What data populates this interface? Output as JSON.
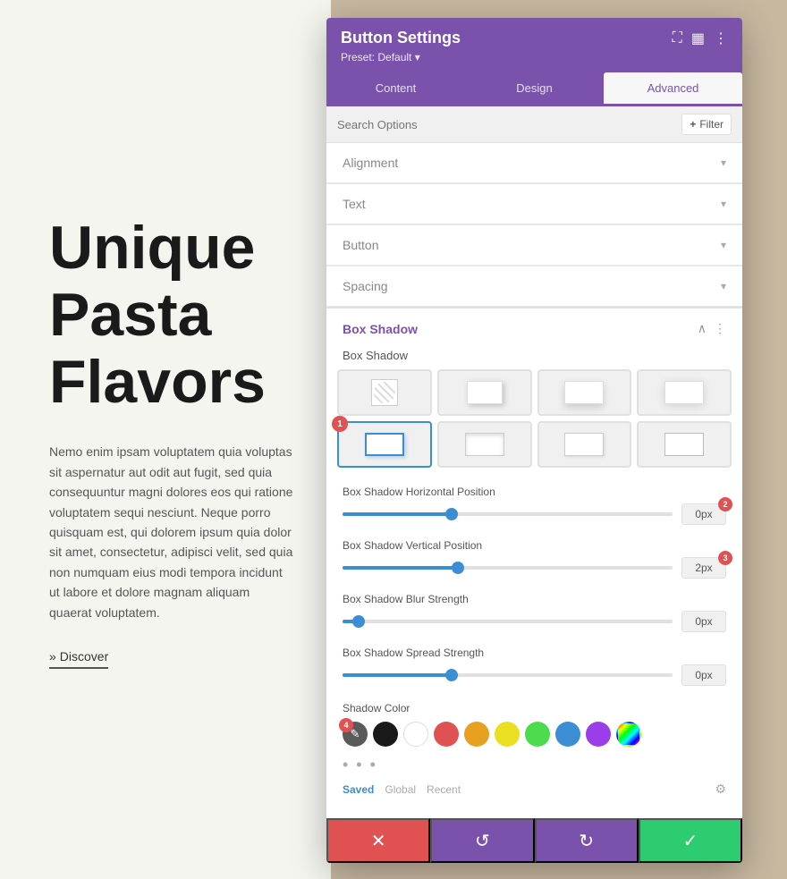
{
  "background": {
    "left_color": "#f5f5f0",
    "right_color": "#c8b8a0"
  },
  "page": {
    "title_line1": "Unique",
    "title_line2": "Pasta",
    "title_line3": "Flavors",
    "body_text": "Nemo enim ipsam voluptatem quia voluptas sit aspernatur aut odit aut fugit, sed quia consequuntur magni dolores eos qui ratione voluptatem sequi nesciunt. Neque porro quisquam est, qui dolorem ipsum quia dolor sit amet, consectetur, adipisci velit, sed quia non numquam eius modi tempora incidunt ut labore et dolore magnam aliquam quaerat voluptatem.",
    "link_text": "Discover"
  },
  "panel": {
    "title": "Button Settings",
    "preset_label": "Preset: Default",
    "tabs": [
      {
        "label": "Content",
        "active": false
      },
      {
        "label": "Design",
        "active": false
      },
      {
        "label": "Advanced",
        "active": true
      }
    ],
    "search_placeholder": "Search Options",
    "filter_label": "Filter",
    "sections": [
      {
        "label": "Alignment"
      },
      {
        "label": "Text"
      },
      {
        "label": "Button"
      },
      {
        "label": "Spacing"
      }
    ],
    "box_shadow": {
      "title": "Box Shadow",
      "shadow_label": "Box Shadow",
      "shadow_options": [
        {
          "type": "none",
          "selected": false
        },
        {
          "type": "box1",
          "selected": false
        },
        {
          "type": "box2",
          "selected": false
        },
        {
          "type": "box3",
          "selected": false
        },
        {
          "type": "box4",
          "selected": true,
          "badge": "1"
        },
        {
          "type": "box5",
          "selected": false
        },
        {
          "type": "box6",
          "selected": false
        },
        {
          "type": "box7",
          "selected": false
        }
      ],
      "sliders": [
        {
          "label": "Box Shadow Horizontal Position",
          "value": "0px",
          "thumb_pct": 33,
          "badge": "2"
        },
        {
          "label": "Box Shadow Vertical Position",
          "value": "2px",
          "thumb_pct": 35,
          "badge": "3"
        },
        {
          "label": "Box Shadow Blur Strength",
          "value": "0px",
          "thumb_pct": 5
        },
        {
          "label": "Box Shadow Spread Strength",
          "value": "0px",
          "thumb_pct": 33
        }
      ],
      "color_label": "Shadow Color",
      "swatches": [
        {
          "color": "#5a5a5a",
          "type": "eyedropper",
          "badge": "4"
        },
        {
          "color": "#1a1a1a"
        },
        {
          "color": "#ffffff"
        },
        {
          "color": "#e05252"
        },
        {
          "color": "#e8a020"
        },
        {
          "color": "#e8e020"
        },
        {
          "color": "#4cdb4c"
        },
        {
          "color": "#3b8ed4"
        },
        {
          "color": "#9b3de8"
        },
        {
          "color": "rainbow"
        }
      ],
      "preset_tabs": [
        "Saved",
        "Global",
        "Recent"
      ],
      "active_preset_tab": "Saved"
    },
    "footer": {
      "cancel_icon": "✕",
      "undo_icon": "↺",
      "redo_icon": "↻",
      "confirm_icon": "✓"
    }
  }
}
